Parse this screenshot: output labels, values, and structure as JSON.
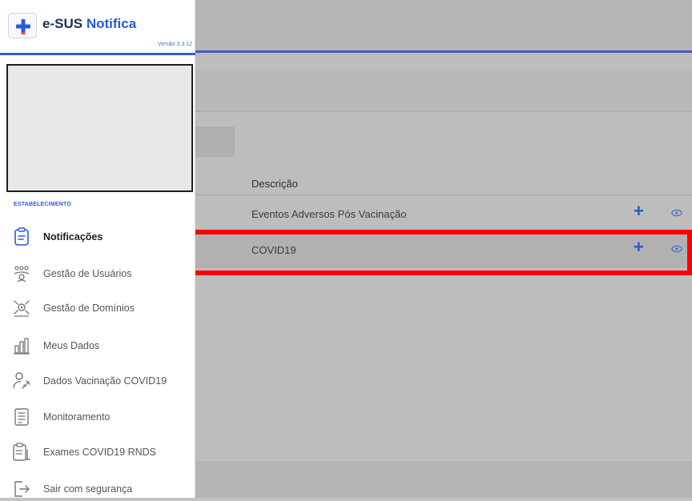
{
  "app": {
    "brand_prefix": "e-SUS",
    "brand_accent": "Notifica",
    "version": "Versão 3.3.12"
  },
  "sidebar": {
    "section_label": "ESTABELECIMENTO",
    "items": [
      {
        "label": "Notificações",
        "icon": "clipboard-icon",
        "active": true
      },
      {
        "label": "Gestão de Usuários",
        "icon": "users-group-icon"
      },
      {
        "label": "Gestão de Domínios",
        "icon": "domains-icon"
      },
      {
        "label": "Meus Dados",
        "icon": "bar-chart-icon"
      },
      {
        "label": "Dados Vacinação COVID19",
        "icon": "user-syringe-icon"
      },
      {
        "label": "Monitoramento",
        "icon": "monitor-list-icon"
      },
      {
        "label": "Exames COVID19 RNDS",
        "icon": "exam-clipboard-icon"
      },
      {
        "label": "Sair com segurança",
        "icon": "logout-icon"
      }
    ]
  },
  "table": {
    "header": "Descrição",
    "rows": [
      {
        "description": "Eventos Adversos Pós Vacinação",
        "add_label": "+"
      },
      {
        "description": "COVID19",
        "add_label": "+"
      }
    ]
  },
  "colors": {
    "accent": "#2a5bd7",
    "highlight": "#ff0000"
  }
}
